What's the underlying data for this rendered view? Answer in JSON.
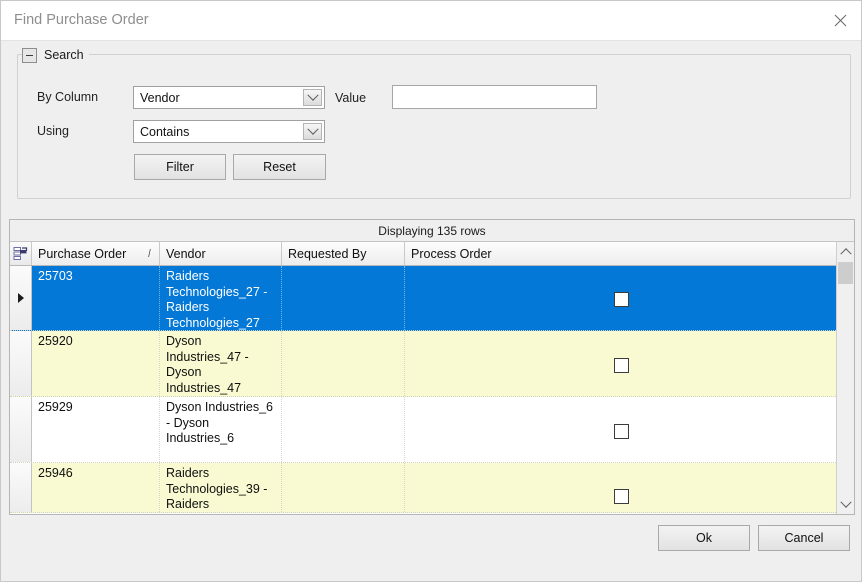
{
  "window": {
    "title": "Find Purchase Order",
    "close_icon": "close-icon"
  },
  "search": {
    "legend": "Search",
    "collapse_icon": "minus-icon",
    "by_column_label": "By Column",
    "by_column_value": "Vendor",
    "using_label": "Using",
    "using_value": "Contains",
    "value_label": "Value",
    "value_text": "",
    "value_placeholder": "",
    "filter_button": "Filter",
    "reset_button": "Reset"
  },
  "grid": {
    "status": "Displaying 135 rows",
    "corner_icon": "select-all-grid-icon",
    "sort_indicator": "/",
    "columns": [
      {
        "key": "purchase_order",
        "label": "Purchase Order"
      },
      {
        "key": "vendor",
        "label": "Vendor"
      },
      {
        "key": "requested_by",
        "label": "Requested By"
      },
      {
        "key": "process_order",
        "label": "Process Order"
      }
    ],
    "rows": [
      {
        "purchase_order": "25703",
        "vendor": "Raiders Technologies_27 - Raiders Technologies_27",
        "requested_by": "",
        "process_order_checked": false,
        "selected": true,
        "current": true
      },
      {
        "purchase_order": "25920",
        "vendor": "Dyson Industries_47 - Dyson Industries_47",
        "requested_by": "",
        "process_order_checked": false,
        "selected": false,
        "current": false
      },
      {
        "purchase_order": "25929",
        "vendor": "Dyson Industries_6 - Dyson Industries_6",
        "requested_by": "",
        "process_order_checked": false,
        "selected": false,
        "current": false
      },
      {
        "purchase_order": "25946",
        "vendor": "Raiders Technologies_39 - Raiders",
        "requested_by": "",
        "process_order_checked": false,
        "selected": false,
        "current": false
      }
    ],
    "scrollbar": {
      "up_icon": "chevron-up-icon",
      "down_icon": "chevron-down-icon"
    }
  },
  "footer": {
    "ok_button": "Ok",
    "cancel_button": "Cancel"
  },
  "colors": {
    "selection_blue": "#0478d7",
    "alt_row_yellow": "#fafad2",
    "dialog_background": "#efefef",
    "title_text": "#8e8e8e"
  }
}
